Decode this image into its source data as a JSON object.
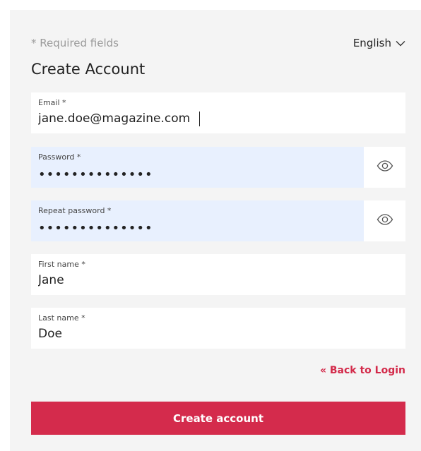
{
  "header": {
    "required_note": "* Required fields",
    "language": "English",
    "title": "Create Account"
  },
  "fields": {
    "email": {
      "label": "Email *",
      "value": "jane.doe@magazine.com"
    },
    "password": {
      "label": "Password *",
      "value": "••••••••••••••"
    },
    "repeat_password": {
      "label": "Repeat password *",
      "value": "••••••••••••••"
    },
    "first_name": {
      "label": "First name *",
      "value": "Jane"
    },
    "last_name": {
      "label": "Last name *",
      "value": "Doe"
    }
  },
  "links": {
    "back_to_login": "« Back to Login"
  },
  "actions": {
    "create_account": "Create account"
  },
  "icons": {
    "language_dropdown": "chevron-down-icon",
    "password_toggle": "eye-icon"
  },
  "colors": {
    "accent": "#d42b4c",
    "panel_bg": "#f4f4f4",
    "autofill_bg": "#e8f0fe"
  }
}
